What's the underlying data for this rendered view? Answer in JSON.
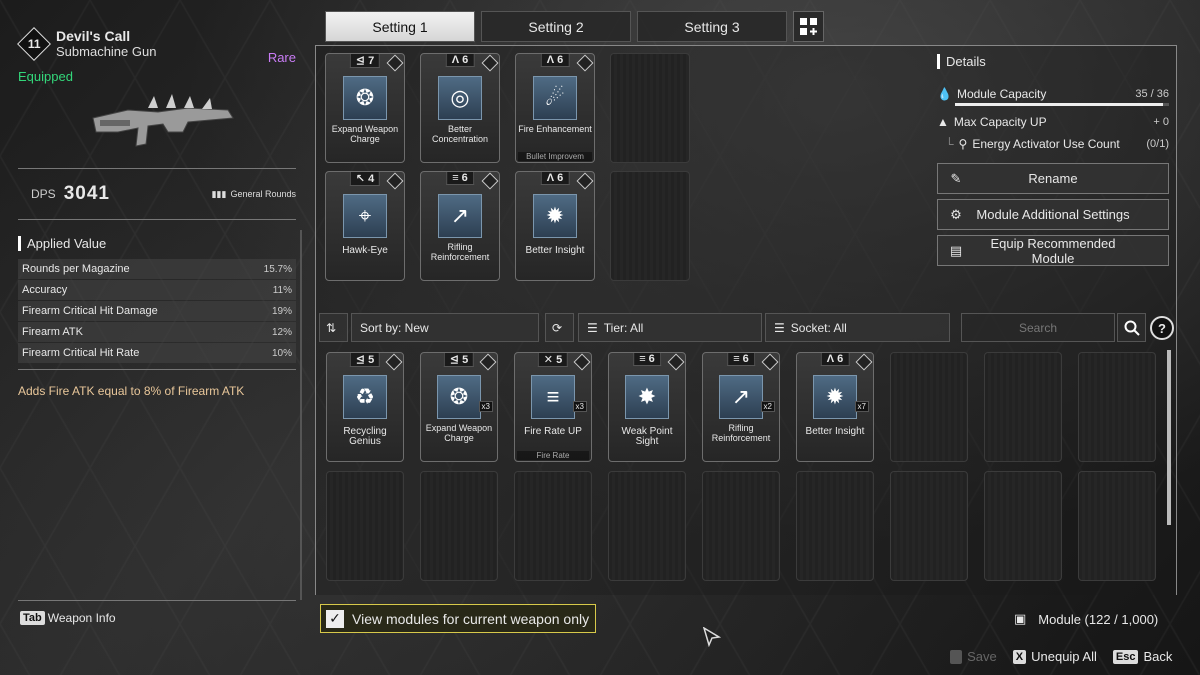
{
  "weapon": {
    "level": "11",
    "name": "Devil's Call",
    "type": "Submachine Gun",
    "rarity": "Rare",
    "status": "Equipped",
    "dps_label": "DPS",
    "dps_value": "3041",
    "ammo_type": "General Rounds",
    "applied_title": "Applied Value",
    "stats": [
      {
        "name": "Rounds per Magazine",
        "value": "15.7%"
      },
      {
        "name": "Accuracy",
        "value": "11%"
      },
      {
        "name": "Firearm Critical Hit Damage",
        "value": "19%"
      },
      {
        "name": "Firearm ATK",
        "value": "12%"
      },
      {
        "name": "Firearm Critical Hit Rate",
        "value": "10%"
      }
    ],
    "effect": "Adds Fire ATK equal to 8% of Firearm ATK",
    "info_key": "Tab",
    "info_label": "Weapon Info"
  },
  "tabs": [
    "Setting 1",
    "Setting 2",
    "Setting 3"
  ],
  "equipped_modules": [
    {
      "cost": "7",
      "name": "Expand Weapon Charge",
      "sub": "",
      "icon": "revolver-cylinder-icon",
      "glyph": "❂"
    },
    {
      "cost": "6",
      "name": "Better Concentration",
      "sub": "",
      "icon": "drum-icon",
      "glyph": "◎"
    },
    {
      "cost": "6",
      "name": "Fire Enhancement",
      "sub": "Bullet Improvem",
      "icon": "fire-bullet-icon",
      "glyph": "☄"
    },
    {
      "cost": "4",
      "name": "Hawk-Eye",
      "sub": "",
      "icon": "crosshair-icon",
      "glyph": "⌖"
    },
    {
      "cost": "6",
      "name": "Rifling Reinforcement",
      "sub": "",
      "icon": "rifling-icon",
      "glyph": "↗"
    },
    {
      "cost": "6",
      "name": "Better Insight",
      "sub": "",
      "icon": "burst-icon",
      "glyph": "✹"
    }
  ],
  "details": {
    "title": "Details",
    "capacity_label": "Module Capacity",
    "capacity_value": "35 / 36",
    "capacity_fraction": 0.972,
    "max_cap_label": "Max Capacity UP",
    "max_cap_value": "+ 0",
    "activator_label": "Energy Activator Use Count",
    "activator_value": "(0/1)",
    "buttons": [
      "Rename",
      "Module Additional Settings",
      "Equip Recommended Module"
    ]
  },
  "filters": {
    "sort": "Sort by: New",
    "tier": "Tier: All",
    "socket": "Socket: All",
    "search_placeholder": "Search",
    "help": "?"
  },
  "inventory": [
    {
      "cost": "5",
      "name": "Recycling Genius",
      "count": "",
      "sub": "",
      "glyph": "♻"
    },
    {
      "cost": "5",
      "name": "Expand Weapon Charge",
      "count": "x3",
      "sub": "",
      "glyph": "❂"
    },
    {
      "cost": "5",
      "name": "Fire Rate UP",
      "count": "x3",
      "sub": "Fire Rate",
      "glyph": "≡"
    },
    {
      "cost": "6",
      "name": "Weak Point Sight",
      "count": "",
      "sub": "",
      "glyph": "✸"
    },
    {
      "cost": "6",
      "name": "Rifling Reinforcement",
      "count": "x2",
      "sub": "",
      "glyph": "↗"
    },
    {
      "cost": "6",
      "name": "Better Insight",
      "count": "x7",
      "sub": "",
      "glyph": "✹"
    }
  ],
  "view_current_only": "View modules for current weapon only",
  "module_count": "Module (122 / 1,000)",
  "bottom": {
    "save": "Save",
    "unequip_key": "X",
    "unequip": "Unequip All",
    "back_key": "Esc",
    "back": "Back"
  }
}
